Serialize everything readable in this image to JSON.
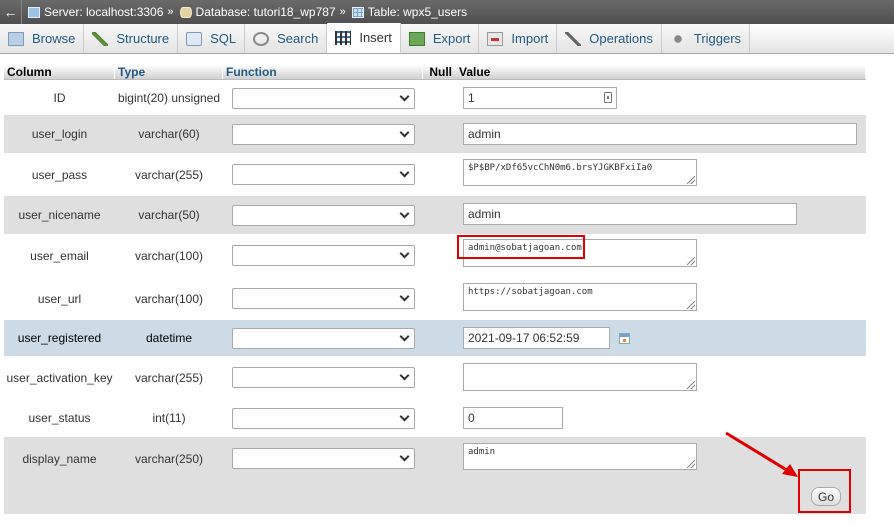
{
  "breadcrumb": {
    "back_label": "←",
    "server": "Server: localhost:3306",
    "database": "Database: tutori18_wp787",
    "table": "Table: wpx5_users",
    "separator": "»"
  },
  "tabs": [
    {
      "label": "Browse",
      "icon": "browse-icon"
    },
    {
      "label": "Structure",
      "icon": "structure-icon"
    },
    {
      "label": "SQL",
      "icon": "sql-icon"
    },
    {
      "label": "Search",
      "icon": "search-icon"
    },
    {
      "label": "Insert",
      "icon": "insert-icon",
      "active": true
    },
    {
      "label": "Export",
      "icon": "export-icon"
    },
    {
      "label": "Import",
      "icon": "import-icon"
    },
    {
      "label": "Operations",
      "icon": "operations-icon"
    },
    {
      "label": "Triggers",
      "icon": "triggers-icon"
    }
  ],
  "table_header": {
    "column": "Column",
    "type": "Type",
    "function": "Function",
    "null": "Null",
    "value": "Value"
  },
  "rows": [
    {
      "column": "ID",
      "type": "bigint(20) unsigned",
      "function": "",
      "value": "1"
    },
    {
      "column": "user_login",
      "type": "varchar(60)",
      "function": "",
      "value": "admin"
    },
    {
      "column": "user_pass",
      "type": "varchar(255)",
      "function": "",
      "value": "$P$BP/xDf65vcChN0m6.brsYJGKBFxiIa0"
    },
    {
      "column": "user_nicename",
      "type": "varchar(50)",
      "function": "",
      "value": "admin"
    },
    {
      "column": "user_email",
      "type": "varchar(100)",
      "function": "",
      "value": "admin@sobatjagoan.com"
    },
    {
      "column": "user_url",
      "type": "varchar(100)",
      "function": "",
      "value": "https://sobatjagoan.com"
    },
    {
      "column": "user_registered",
      "type": "datetime",
      "function": "",
      "value": "2021-09-17 06:52:59"
    },
    {
      "column": "user_activation_key",
      "type": "varchar(255)",
      "function": "",
      "value": ""
    },
    {
      "column": "user_status",
      "type": "int(11)",
      "function": "",
      "value": "0"
    },
    {
      "column": "display_name",
      "type": "varchar(250)",
      "function": "",
      "value": "admin"
    }
  ],
  "go_button": "Go",
  "colors": {
    "accent_link": "#235a81",
    "highlight_row": "#ccdbe6",
    "annotation_red": "#e00000"
  }
}
